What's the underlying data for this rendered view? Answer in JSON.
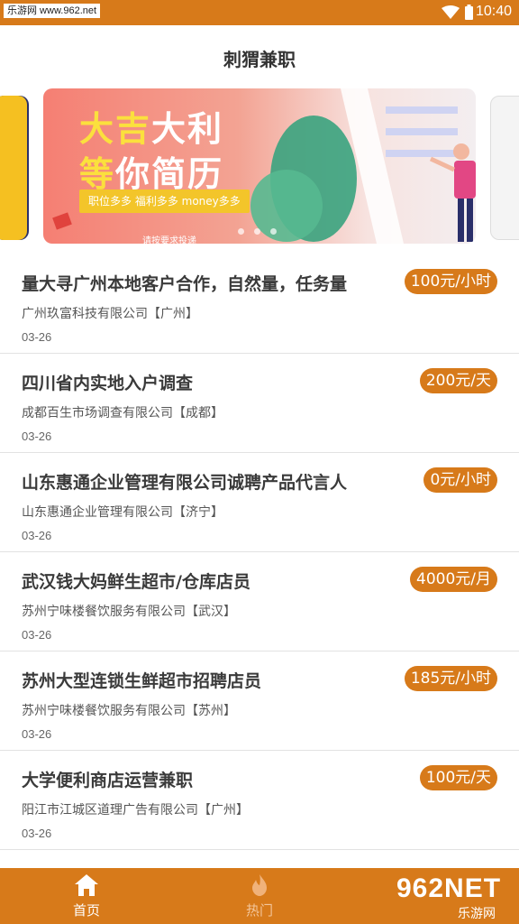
{
  "status": {
    "watermark": "乐游网 www.962.net",
    "time": "10:40"
  },
  "header": {
    "title": "刺猬兼职"
  },
  "banner": {
    "line1a": "大吉",
    "line1b": "大",
    "line1c": "利",
    "line2a": "等",
    "line2b": "你简历",
    "tagline": "职位多多  福利多多  money多多",
    "caption": "请按要求投递"
  },
  "jobs": [
    {
      "title": "量大寻广州本地客户合作，自然量，任务量",
      "company": "广州玖富科技有限公司【广州】",
      "date": "03-26",
      "salary": "100元/小时"
    },
    {
      "title": "四川省内实地入户调查",
      "company": "成都百生市场调查有限公司【成都】",
      "date": "03-26",
      "salary": "200元/天"
    },
    {
      "title": "山东惠通企业管理有限公司诚聘产品代言人",
      "company": "山东惠通企业管理有限公司【济宁】",
      "date": "03-26",
      "salary": "0元/小时"
    },
    {
      "title": "武汉钱大妈鲜生超市/仓库店员",
      "company": "苏州宁味楼餐饮服务有限公司【武汉】",
      "date": "03-26",
      "salary": "4000元/月"
    },
    {
      "title": "苏州大型连锁生鲜超市招聘店员",
      "company": "苏州宁味楼餐饮服务有限公司【苏州】",
      "date": "03-26",
      "salary": "185元/小时"
    },
    {
      "title": "大学便利商店运营兼职",
      "company": "阳江市江城区道理广告有限公司【广州】",
      "date": "03-26",
      "salary": "100元/天"
    }
  ],
  "nav": {
    "home": "首页",
    "hot": "热门"
  },
  "watermark2": {
    "big": "962NET",
    "small": "乐游网"
  },
  "colors": {
    "accent": "#d77a1a",
    "pill_yellow": "#f3c52a"
  }
}
